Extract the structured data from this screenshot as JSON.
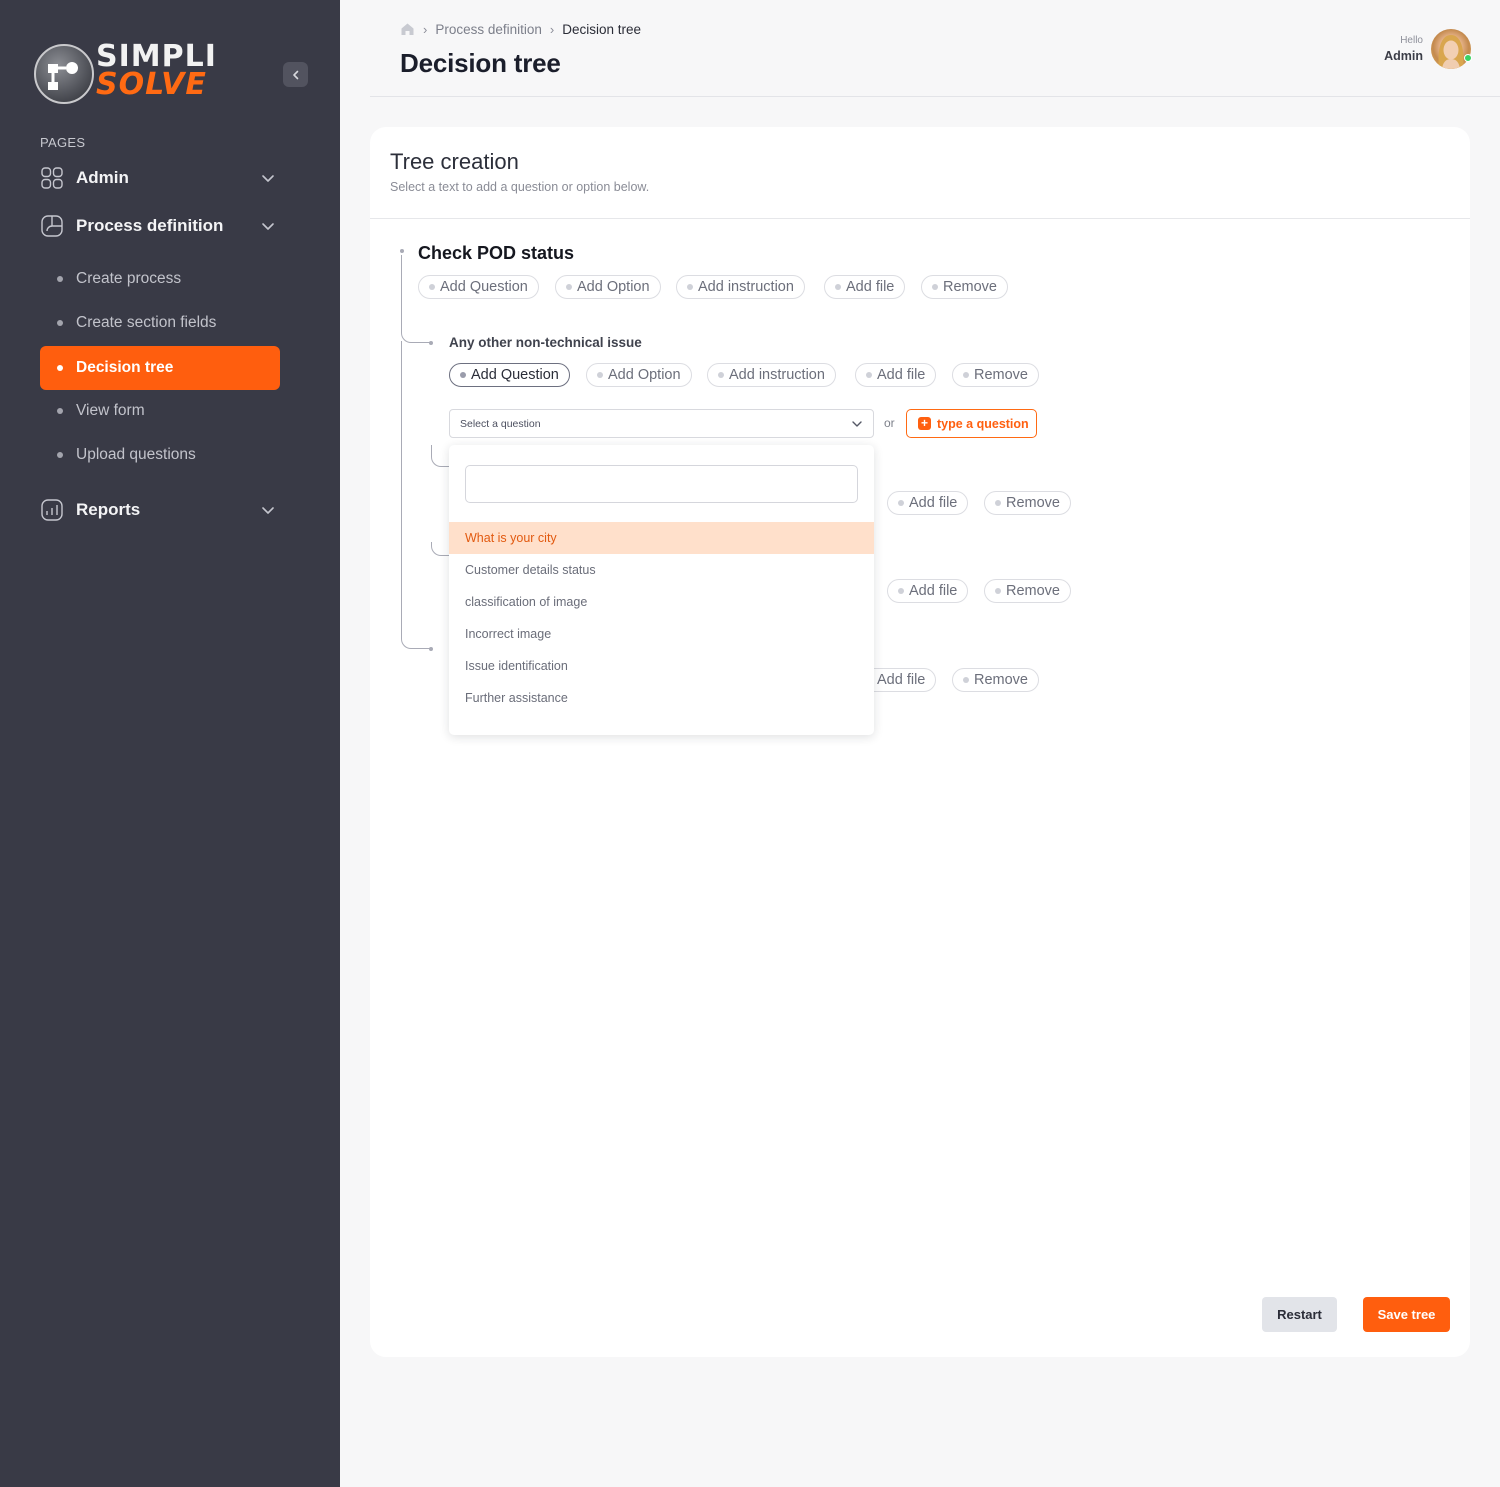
{
  "app": {
    "logo_line1": "SIMPLI",
    "logo_line2": "SOLVE",
    "brand_color": "#ff5e0e",
    "sidebar_color": "#393a46"
  },
  "sidebar": {
    "section_label": "PAGES",
    "groups": [
      {
        "label": "Admin",
        "icon": "grid-icon",
        "expanded": false
      },
      {
        "label": "Process definition",
        "icon": "process-icon",
        "expanded": true,
        "items": [
          {
            "label": "Create process",
            "active": false
          },
          {
            "label": "Create section fields",
            "active": false
          },
          {
            "label": "Decision tree",
            "active": true
          },
          {
            "label": "View form",
            "active": false
          },
          {
            "label": "Upload questions",
            "active": false
          }
        ]
      },
      {
        "label": "Reports",
        "icon": "chart-icon",
        "expanded": false
      }
    ]
  },
  "header": {
    "breadcrumb": [
      "Process definition",
      "Decision tree"
    ],
    "title": "Decision tree",
    "greeting": "Hello",
    "user_name": "Admin",
    "status_color": "#3ad264"
  },
  "card": {
    "title": "Tree creation",
    "subtitle": "Select a text to add a question or option below."
  },
  "tree": {
    "root": {
      "title": "Check POD status",
      "actions": [
        "Add Question",
        "Add Option",
        "Add instruction",
        "Add file",
        "Remove"
      ]
    },
    "child": {
      "title": "Any other non-technical issue",
      "actions": [
        "Add Question",
        "Add Option",
        "Add instruction",
        "Add file",
        "Remove"
      ],
      "active_action": "Add Question"
    },
    "hidden_rows": [
      {
        "actions": [
          "Add file",
          "Remove"
        ]
      },
      {
        "actions": [
          "Add file",
          "Remove"
        ]
      },
      {
        "actions": [
          "Add file",
          "Remove"
        ]
      }
    ]
  },
  "question_picker": {
    "placeholder": "Select a question",
    "or_text": "or",
    "type_button": "type a question",
    "search_value": "",
    "options": [
      {
        "label": "What is your city",
        "highlighted": true
      },
      {
        "label": "Customer details status",
        "highlighted": false
      },
      {
        "label": "classification of image",
        "highlighted": false
      },
      {
        "label": "Incorrect image",
        "highlighted": false
      },
      {
        "label": "Issue identification",
        "highlighted": false
      },
      {
        "label": "Further assistance",
        "highlighted": false
      }
    ]
  },
  "footer": {
    "restart_label": "Restart",
    "save_label": "Save tree"
  }
}
